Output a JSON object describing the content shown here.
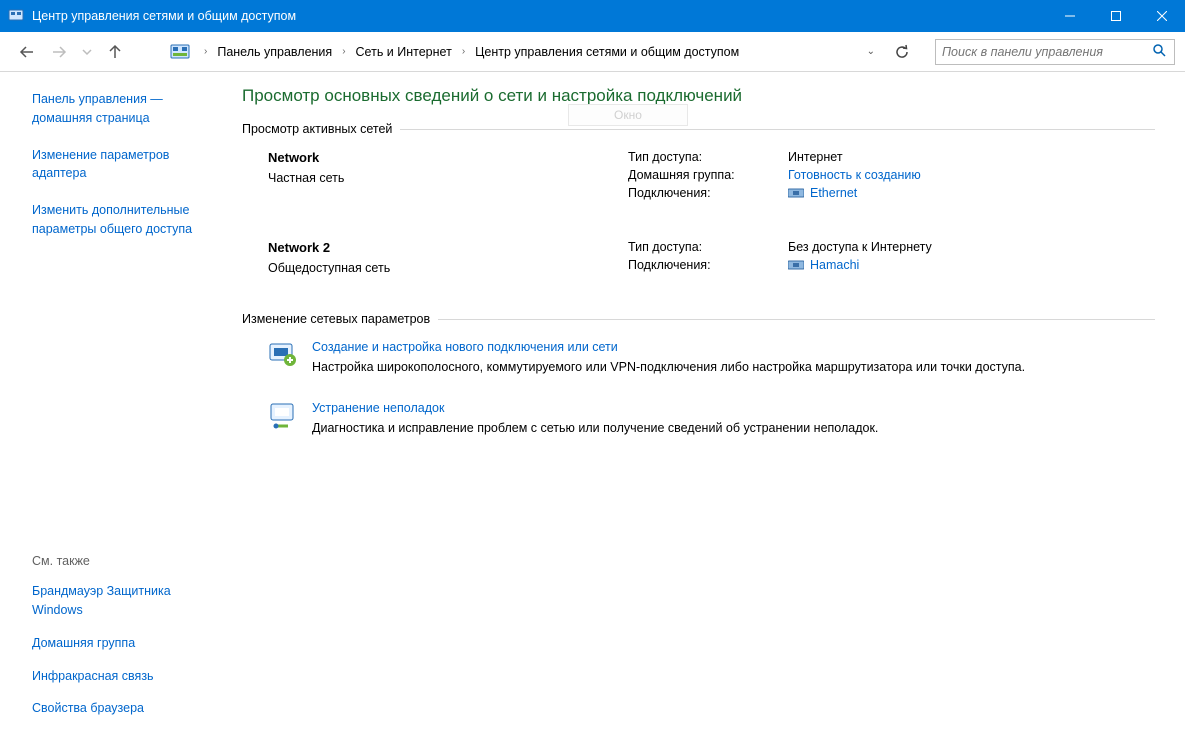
{
  "window": {
    "title": "Центр управления сетями и общим доступом"
  },
  "breadcrumb": {
    "items": [
      "Панель управления",
      "Сеть и Интернет",
      "Центр управления сетями и общим доступом"
    ]
  },
  "search": {
    "placeholder": "Поиск в панели управления"
  },
  "sidebar": {
    "top": [
      "Панель управления — домашняя страница",
      "Изменение параметров адаптера",
      "Изменить дополнительные параметры общего доступа"
    ],
    "see_also_header": "См. также",
    "see_also": [
      "Брандмауэр Защитника Windows",
      "Домашняя группа",
      "Инфракрасная связь",
      "Свойства браузера"
    ]
  },
  "main": {
    "title": "Просмотр основных сведений о сети и настройка подключений",
    "active_networks_header": "Просмотр активных сетей",
    "watermark": "Окно",
    "networks": [
      {
        "name": "Network",
        "kind": "Частная сеть",
        "rows": [
          {
            "label": "Тип доступа:",
            "value": "Интернет",
            "link": false
          },
          {
            "label": "Домашняя группа:",
            "value": "Готовность к созданию",
            "link": true
          },
          {
            "label": "Подключения:",
            "value": "Ethernet",
            "link": true,
            "icon": true
          }
        ]
      },
      {
        "name": "Network  2",
        "kind": "Общедоступная сеть",
        "rows": [
          {
            "label": "Тип доступа:",
            "value": "Без доступа к Интернету",
            "link": false
          },
          {
            "label": "Подключения:",
            "value": "Hamachi",
            "link": true,
            "icon": true
          }
        ]
      }
    ],
    "change_settings_header": "Изменение сетевых параметров",
    "settings": [
      {
        "title": "Создание и настройка нового подключения или сети",
        "desc": "Настройка широкополосного, коммутируемого или VPN-подключения либо настройка маршрутизатора или точки доступа."
      },
      {
        "title": "Устранение неполадок",
        "desc": "Диагностика и исправление проблем с сетью или получение сведений об устранении неполадок."
      }
    ]
  }
}
